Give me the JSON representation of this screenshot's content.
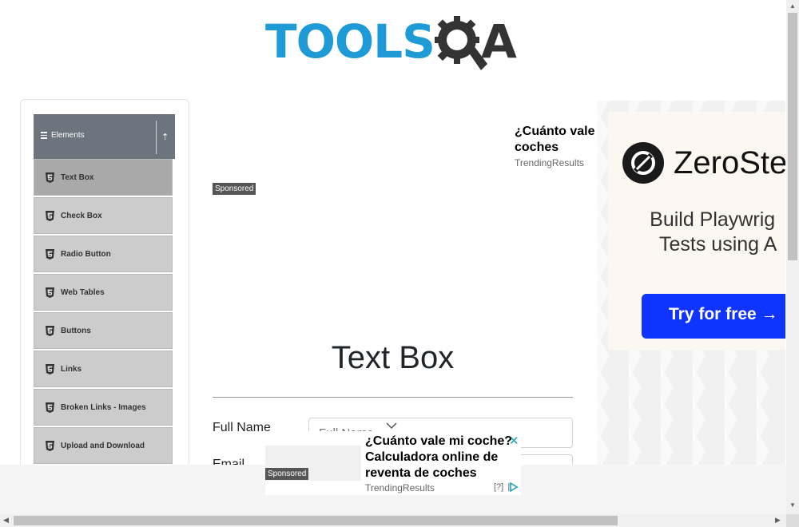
{
  "logo": {
    "text": "TOOLS",
    "suffix": "A",
    "primary_color": "#1e9ad6",
    "secondary_color": "#333333"
  },
  "sidebar": {
    "group_label": "Elements",
    "group_icon": "menu-icon",
    "collapse_icon": "upload-arrow-icon",
    "items": [
      {
        "label": "Text Box",
        "icon": "html5-icon",
        "active": true
      },
      {
        "label": "Check Box",
        "icon": "html5-icon"
      },
      {
        "label": "Radio Button",
        "icon": "html5-icon"
      },
      {
        "label": "Web Tables",
        "icon": "html5-icon"
      },
      {
        "label": "Buttons",
        "icon": "html5-icon"
      },
      {
        "label": "Links",
        "icon": "html5-icon"
      },
      {
        "label": "Broken Links - Images",
        "icon": "html5-icon"
      },
      {
        "label": "Upload and Download",
        "icon": "html5-icon"
      }
    ]
  },
  "top_ad": {
    "headline": "¿Cuánto vale coches",
    "source": "TrendingResults",
    "sponsored": "Sponsored"
  },
  "right_ad": {
    "brand": "ZeroSte",
    "tagline_line1": "Build Playwrig",
    "tagline_line2": "Tests using A",
    "cta": "Try for free →",
    "cta_color": "#1034ff"
  },
  "main": {
    "title": "Text Box",
    "full_name_label": "Full Name",
    "full_name_placeholder": "Full Name",
    "email_label": "Email"
  },
  "bottom_ad": {
    "sponsored": "Sponsored",
    "headline": "¿Cuánto vale mi coche? Calculadora online de reventa de coches",
    "source": "TrendingResults",
    "help": "[?]",
    "close": "✕"
  }
}
